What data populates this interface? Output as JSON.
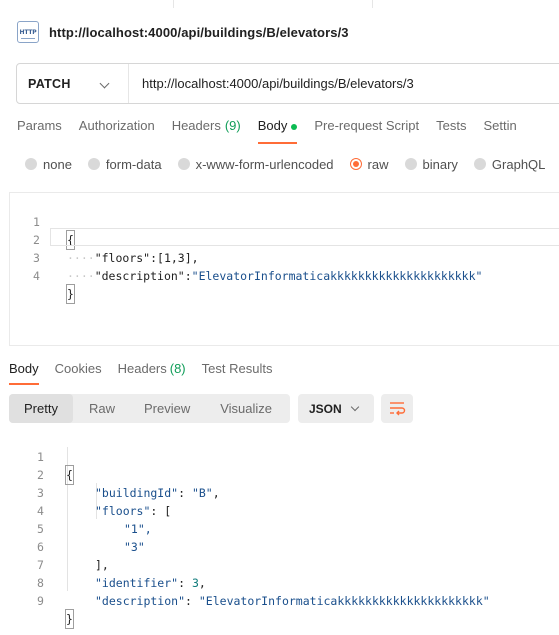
{
  "request": {
    "title": "http://localhost:4000/api/buildings/B/elevators/3",
    "icon": "http-file-icon",
    "icon_text": "HTTP",
    "method": "PATCH",
    "url": "http://localhost:4000/api/buildings/B/elevators/3"
  },
  "request_tabs": {
    "params": "Params",
    "authorization": "Authorization",
    "headers": "Headers",
    "headers_count": "(9)",
    "body": "Body",
    "pre_request": "Pre-request Script",
    "tests": "Tests",
    "settings": "Settin"
  },
  "body_types": {
    "none": "none",
    "form_data": "form-data",
    "urlencoded": "x-www-form-urlencoded",
    "raw": "raw",
    "binary": "binary",
    "graphql": "GraphQL",
    "selected": "raw"
  },
  "request_body": {
    "line_numbers": [
      "1",
      "2",
      "3",
      "4"
    ],
    "open_brace": "{",
    "close_brace": "}",
    "floors_key": "\"floors\"",
    "floors_value": "[1,3]",
    "description_key": "\"description\"",
    "description_value": "\"ElevatorInformaticakkkkkkkkkkkkkkkkkkkkk\""
  },
  "response_tabs": {
    "body": "Body",
    "cookies": "Cookies",
    "headers": "Headers",
    "headers_count": "(8)",
    "test_results": "Test Results"
  },
  "response_view": {
    "pretty": "Pretty",
    "raw": "Raw",
    "preview": "Preview",
    "visualize": "Visualize",
    "format": "JSON",
    "wrap_icon": "wrap-lines-icon"
  },
  "response_body": {
    "line_numbers": [
      "1",
      "2",
      "3",
      "4",
      "5",
      "6",
      "7",
      "8",
      "9"
    ],
    "open_brace": "{",
    "close_brace": "}",
    "building_key": "\"buildingId\"",
    "building_value": "\"B\"",
    "floors_key": "\"floors\"",
    "floors_open": "[",
    "floor_1": "\"1\",",
    "floor_2": "\"3\"",
    "floors_close": "],",
    "identifier_key": "\"identifier\"",
    "identifier_value": "3",
    "description_key": "\"description\"",
    "description_value": "\"ElevatorInformaticakkkkkkkkkkkkkkkkkkkkk\""
  },
  "colors": {
    "accent": "#ff6c37",
    "success": "#0cbb52",
    "string": "#1a4f8c"
  }
}
